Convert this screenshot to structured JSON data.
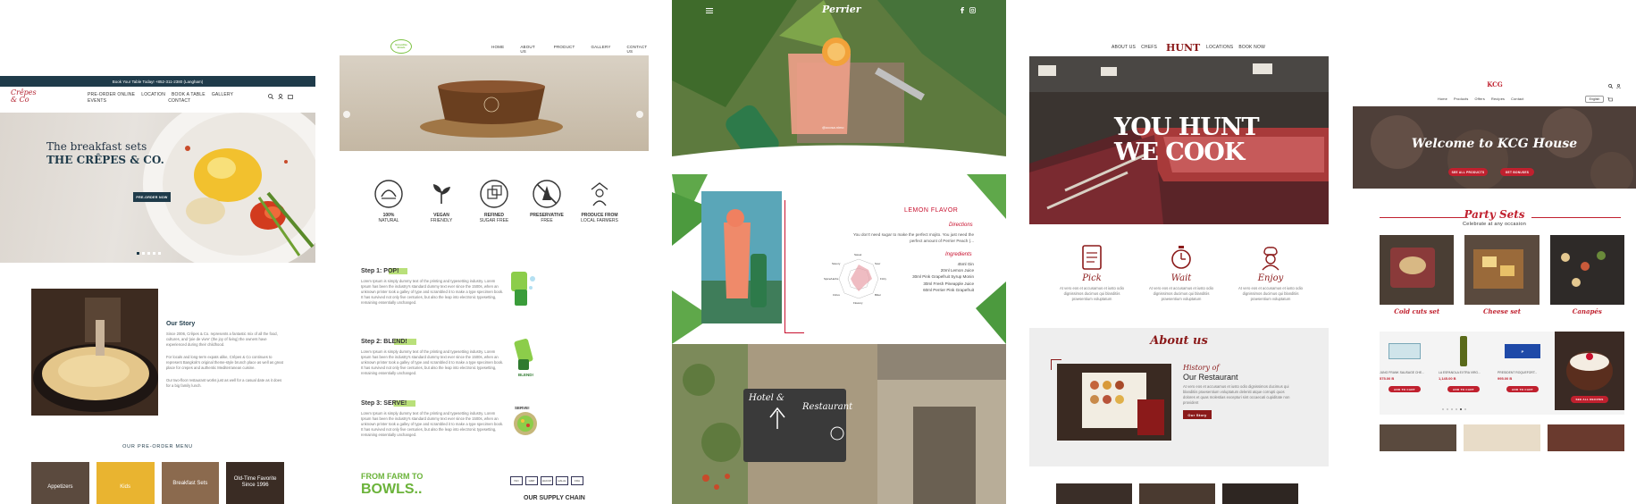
{
  "panel1": {
    "topbar": "Book Your Table Today! +852-311-2380 (Langham)",
    "logo": "Crêpes & Co",
    "nav": [
      "PRE-ORDER ONLINE",
      "LOCATION",
      "BOOK A TABLE",
      "GALLERY",
      "EVENTS",
      "CONTACT"
    ],
    "hero_title_1": "The breakfast sets",
    "hero_title_2": "THE CRÊPES & CO.",
    "hero_button": "PRE-ORDER NOW",
    "story_title": "Our Story",
    "story_p1": "Since 2006, Crêpes & Co. represents a fantastic mix of all the food, cultures, and 'joie de vivre' (the joy of living) the owners have experienced during their childhood.",
    "story_p2": "For locals and long-term expats alike, Crêpes & Co continues to represent Bangkok's original theme-style brunch place as well as great place for crepes and authentic Mediterranean cuisine.",
    "story_p3": "Our two-floor restaurant works just as well for a casual date as it does for a big family lunch.",
    "menu_heading": "OUR PRE-ORDER MENU",
    "menu_items": [
      "Appetizers",
      "Kids",
      "Breakfast Sets",
      "Old-Time Favorite Since 1996"
    ]
  },
  "panel2": {
    "logo": "Smoothie Bowls",
    "nav": [
      "HOME",
      "ABOUT US",
      "PRODUCT",
      "GALLERY",
      "CONTACT US"
    ],
    "features": [
      {
        "l1": "100%",
        "l2": "NATURAL"
      },
      {
        "l1": "VEGAN",
        "l2": "FRIENDLY"
      },
      {
        "l1": "REFINED",
        "l2": "SUGAR FREE"
      },
      {
        "l1": "PRESERVATIVE",
        "l2": "FREE"
      },
      {
        "l1": "PRODUCE FROM",
        "l2": "LOCAL FARMERS"
      }
    ],
    "steps": [
      "Step 1: POP!",
      "Step 2: BLEND!",
      "Step 3: SERVE!"
    ],
    "step_badges": [
      "",
      "BLEND!",
      "SERVE!"
    ],
    "lorem": "Lorem Ipsum is simply dummy text of the printing and typesetting industry. Lorem Ipsum has been the industry's standard dummy text ever since the 1500s, when an unknown printer took a galley of type and scrambled it to make a type specimen book. It has survived not only five centuries, but also the leap into electronic typesetting, remaining essentially unchanged.",
    "farm_1": "FROM FARM TO",
    "farm_2": "BOWLS..",
    "supply": "OUR SUPPLY CHAIN",
    "badges": [
      "ISO",
      "GMP",
      "HACCP",
      "HALAL",
      "FDA"
    ]
  },
  "panel3": {
    "logo": "Perrier",
    "caption": "@ocosa.nimo",
    "flavor": "LEMON FLAVOR",
    "directions_title": "Directions",
    "directions": "You don't need sugar to make the perfect mojito. You just need the perfect amount of Perrier Peach (...",
    "ingredients_title": "Ingredients",
    "ingredients": [
      "45ml Gin",
      "20ml Lemon Juice",
      "30ml Pink Grapefruit Syrup Monin",
      "30ml Fresh Pineapple Juice",
      "60ml Perrier Pink Grapefruit"
    ],
    "radar_labels": [
      "Sweet",
      "Sour",
      "Fizzy",
      "Bitter",
      "Flowery",
      "Citrus",
      "Spice/Herbs",
      "Savory"
    ],
    "sign_1": "Hotel &",
    "sign_2": "Restaurant"
  },
  "panel4": {
    "nav_left": [
      "ABOUT US",
      "CHEFS"
    ],
    "logo": "HUNT",
    "nav_right": [
      "LOCATIONS",
      "BOOK NOW"
    ],
    "hero_1": "YOU HUNT",
    "hero_2": "WE COOK",
    "features": [
      {
        "title": "Pick",
        "text": "At vero eos et accusamus et iusto odio dignissimos ducimus qui blanditiis praesentium voluptatum"
      },
      {
        "title": "Wait",
        "text": "At vero eos et accusamus et iusto odio dignissimos ducimus qui blanditiis praesentium voluptatum"
      },
      {
        "title": "Enjoy",
        "text": "At vero eos et accusamus et iusto odio dignissimos ducimus qui blanditiis praesentium voluptatum"
      }
    ],
    "about_title": "About us",
    "history_1": "History of",
    "history_2": "Our Restaurant",
    "history_text": "At vero eos et accusamus et iusto odio dignissimos ducimus qui blanditiis praesentium voluptatum deleniti atque corrupti quos dolores et quas molestias excepturi sint occaecati cupiditate non provident",
    "story_button": "Our Story"
  },
  "panel5": {
    "logo": "KCG",
    "nav": [
      "Home",
      "Products",
      "Offers",
      "Recipes",
      "Contact"
    ],
    "lang": "English",
    "hero_title": "Welcome to KCG House",
    "hero_btn_1": "SEE ALL PRODUCTS",
    "hero_btn_2": "GET BONUSES",
    "party_title": "Party Sets",
    "party_sub": "Celebrate at any occasion",
    "sets": [
      "Cold cuts set",
      "Cheese set",
      "Canapés"
    ],
    "products": [
      {
        "name": "JUNG FRANK SAUSAGE CHE...",
        "price": "575.00 B"
      },
      {
        "name": "LA ESPANOLA EXTRA VIRG...",
        "price": "1,145.00 B"
      },
      {
        "name": "PRESIDENT ROQUEFORT...",
        "price": "995.00 B"
      }
    ],
    "add_to_cart": "ADD TO CART",
    "see_all": "SEE ALL RECIPES"
  },
  "colors": {
    "panel1_navy": "#1f3b4a",
    "panel2_green": "#7cc242",
    "panel3_red": "#c8102e",
    "panel4_maroon": "#8b1a1a",
    "panel5_red": "#c0202e"
  }
}
